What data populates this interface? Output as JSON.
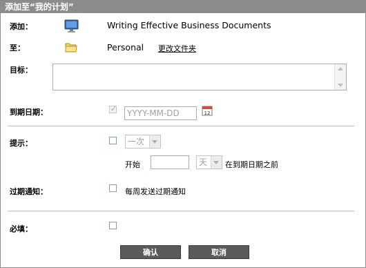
{
  "dialog": {
    "title": "添加至“我的计划”"
  },
  "item": {
    "label": "添加：",
    "name": "Writing Effective Business Documents",
    "icon": "monitor-icon"
  },
  "destination": {
    "label": "至：",
    "folder": "Personal",
    "change_link": "更改文件夹",
    "icon": "folder-icon"
  },
  "goal": {
    "label": "目标：",
    "value": ""
  },
  "due_date": {
    "label": "到期日期：",
    "placeholder": "YYYY-MM-DD",
    "checked": true,
    "icon": "calendar-icon"
  },
  "reminder": {
    "label": "提示：",
    "checked": false,
    "frequency_value": "一次",
    "start_label": "开始",
    "start_value": "",
    "unit_value": "天",
    "before_text": "在到期日期之前"
  },
  "overdue": {
    "label": "过期通知：",
    "checked": false,
    "option_text": "每周发送过期通知"
  },
  "required": {
    "label": "必填：",
    "checked": false
  },
  "buttons": {
    "confirm": "确认",
    "cancel": "取消"
  },
  "colors": {
    "titlebar": "#8c8c8c",
    "button": "#5a5a5a"
  }
}
